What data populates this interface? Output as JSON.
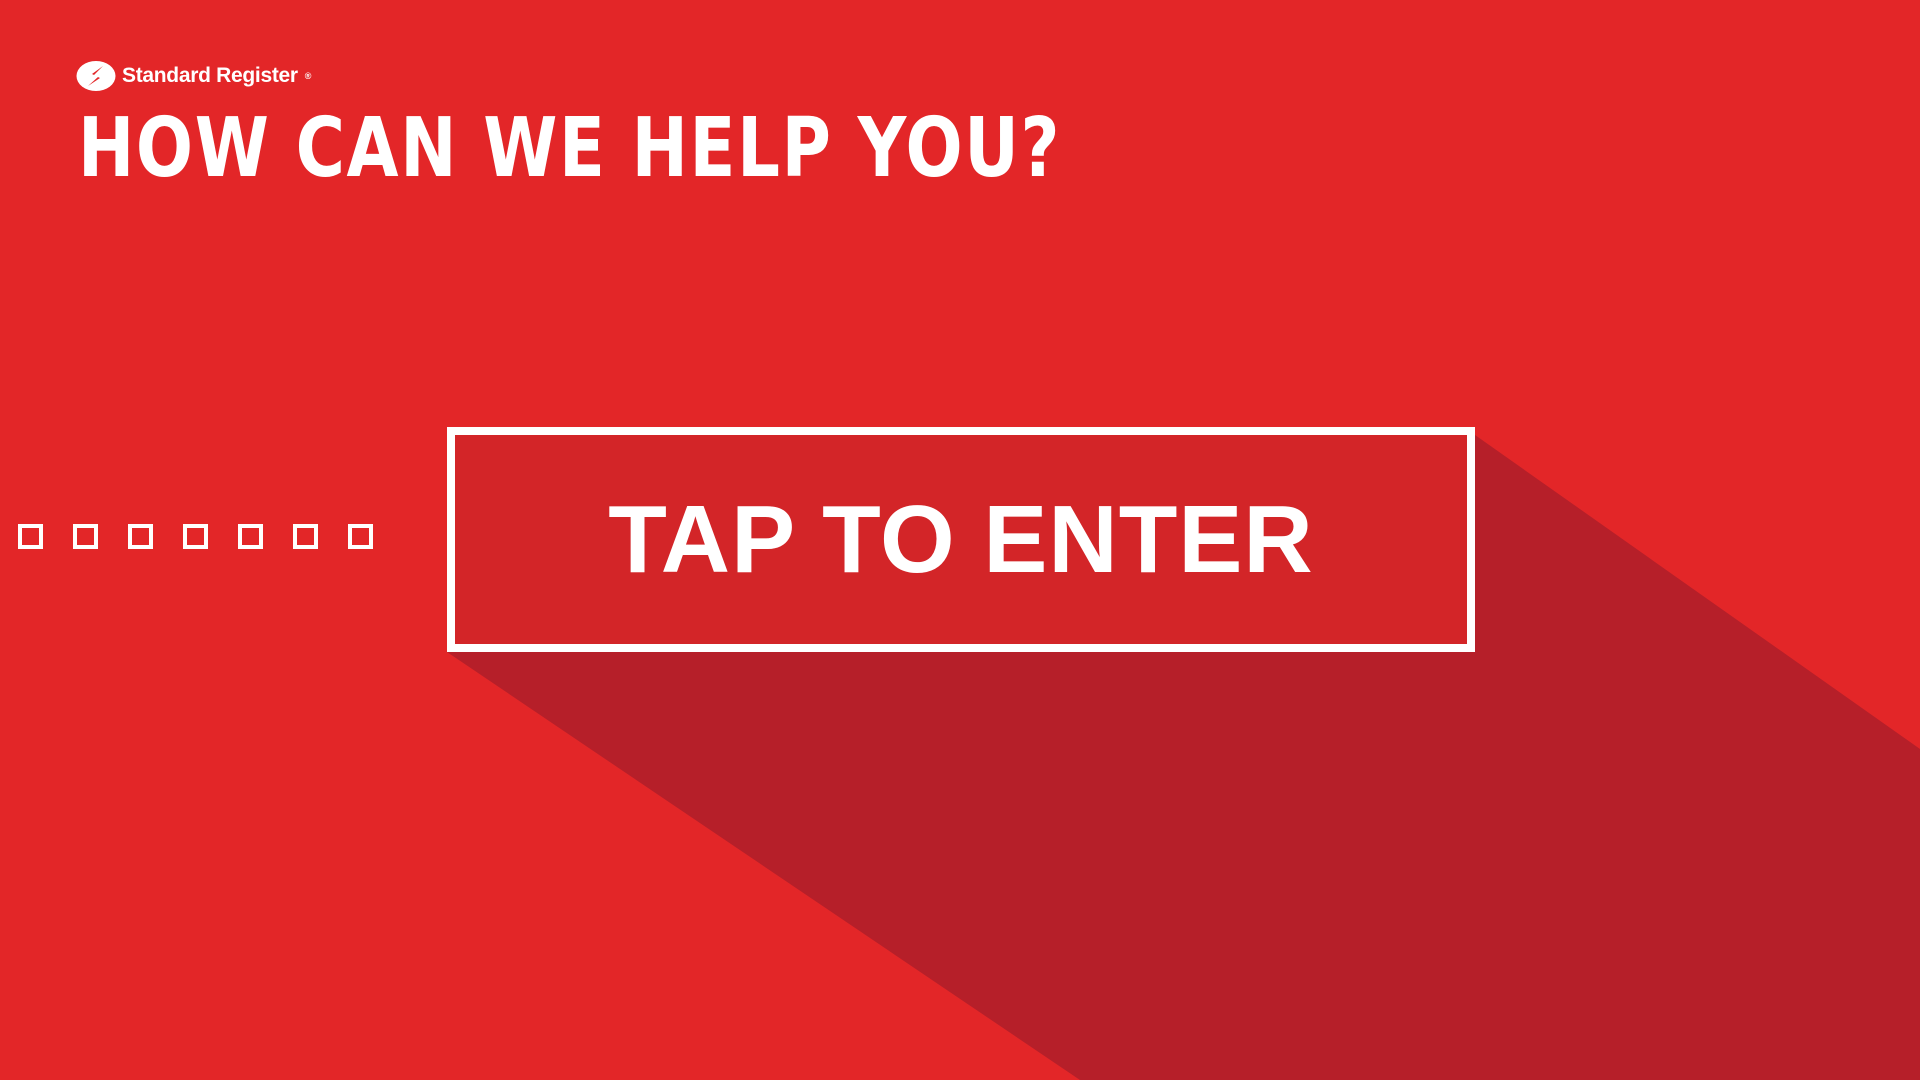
{
  "brand": {
    "name": "Standard Register",
    "registered_mark": "®"
  },
  "headline": "HOW CAN WE HELP YOU?",
  "enter_button": {
    "label": "TAP TO ENTER"
  },
  "pager": {
    "count": 7
  },
  "colors": {
    "background": "#e32628",
    "shadow": "#b61f29",
    "button_fill": "#d32528",
    "foreground": "#ffffff"
  },
  "icons": {
    "logo": "standard-register-s-logo-icon"
  }
}
